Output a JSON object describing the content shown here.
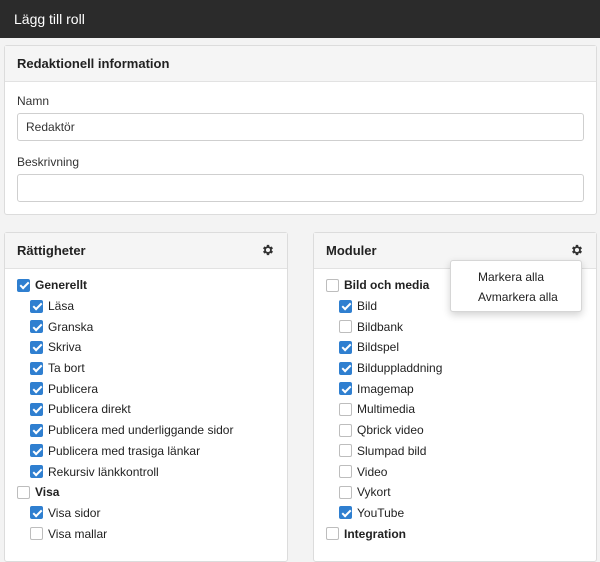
{
  "window": {
    "title": "Lägg till roll"
  },
  "editorial": {
    "heading": "Redaktionell information",
    "name_label": "Namn",
    "name_value": "Redaktör",
    "description_label": "Beskrivning",
    "description_value": ""
  },
  "rights": {
    "heading": "Rättigheter",
    "settings_icon": "gear-icon",
    "items": [
      {
        "label": "Generellt",
        "checked": true,
        "level": 0
      },
      {
        "label": "Läsa",
        "checked": true,
        "level": 1
      },
      {
        "label": "Granska",
        "checked": true,
        "level": 1
      },
      {
        "label": "Skriva",
        "checked": true,
        "level": 1
      },
      {
        "label": "Ta bort",
        "checked": true,
        "level": 1
      },
      {
        "label": "Publicera",
        "checked": true,
        "level": 1
      },
      {
        "label": "Publicera direkt",
        "checked": true,
        "level": 1
      },
      {
        "label": "Publicera med underliggande sidor",
        "checked": true,
        "level": 1
      },
      {
        "label": "Publicera med trasiga länkar",
        "checked": true,
        "level": 1
      },
      {
        "label": "Rekursiv länkkontroll",
        "checked": true,
        "level": 1
      },
      {
        "label": "Visa",
        "checked": false,
        "level": 0
      },
      {
        "label": "Visa sidor",
        "checked": true,
        "level": 1
      },
      {
        "label": "Visa mallar",
        "checked": false,
        "level": 1
      }
    ]
  },
  "modules": {
    "heading": "Moduler",
    "settings_icon": "gear-icon",
    "items": [
      {
        "label": "Bild och media",
        "checked": false,
        "level": 0
      },
      {
        "label": "Bild",
        "checked": true,
        "level": 1
      },
      {
        "label": "Bildbank",
        "checked": false,
        "level": 1
      },
      {
        "label": "Bildspel",
        "checked": true,
        "level": 1
      },
      {
        "label": "Bilduppladdning",
        "checked": true,
        "level": 1
      },
      {
        "label": "Imagemap",
        "checked": true,
        "level": 1
      },
      {
        "label": "Multimedia",
        "checked": false,
        "level": 1
      },
      {
        "label": "Qbrick video",
        "checked": false,
        "level": 1
      },
      {
        "label": "Slumpad bild",
        "checked": false,
        "level": 1
      },
      {
        "label": "Video",
        "checked": false,
        "level": 1
      },
      {
        "label": "Vykort",
        "checked": false,
        "level": 1
      },
      {
        "label": "YouTube",
        "checked": true,
        "level": 1
      },
      {
        "label": "Integration",
        "checked": false,
        "level": 0
      }
    ]
  },
  "dropdown": {
    "select_all": "Markera alla",
    "deselect_all": "Avmarkera alla"
  },
  "colors": {
    "titlebar": "#2b2b2b",
    "accent": "#2f7fd0"
  }
}
